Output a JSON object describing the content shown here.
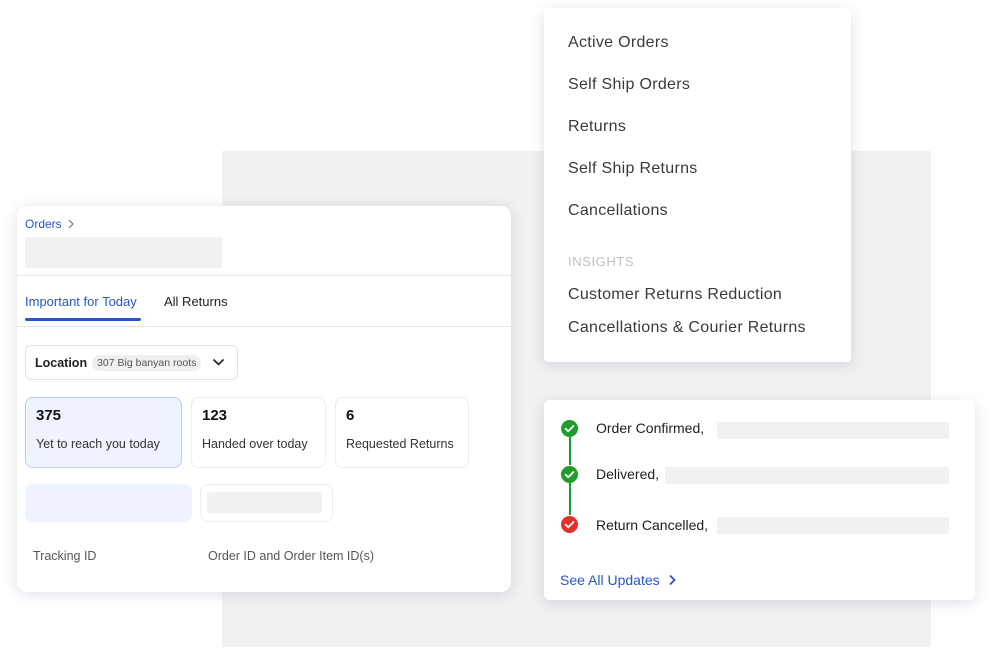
{
  "orders_panel": {
    "breadcrumb": "Orders",
    "tabs": [
      {
        "label": "Important for Today",
        "active": true
      },
      {
        "label": "All Returns",
        "active": false
      }
    ],
    "location": {
      "label": "Location",
      "value": "307 Big banyan roots"
    },
    "stats": [
      {
        "value": "375",
        "label": "Yet to reach you today"
      },
      {
        "value": "123",
        "label": "Handed over today"
      },
      {
        "value": "6",
        "label": "Requested Returns"
      }
    ],
    "columns": [
      "Tracking ID",
      "Order ID and Order Item ID(s)"
    ]
  },
  "menu": {
    "items": [
      "Active Orders",
      "Self Ship Orders",
      "Returns",
      "Self Ship Returns",
      "Cancellations"
    ],
    "section_title": "INSIGHTS",
    "insights": [
      "Customer Returns Reduction",
      "Cancellations & Courier Returns"
    ]
  },
  "updates": {
    "events": [
      {
        "label": "Order Confirmed,",
        "status": "success"
      },
      {
        "label": "Delivered,",
        "status": "success"
      },
      {
        "label": "Return Cancelled,",
        "status": "error"
      }
    ],
    "see_all": "See All Updates"
  },
  "colors": {
    "accent_blue": "#2a55c8",
    "success_green": "#1f9d2a",
    "error_red": "#e2312b",
    "placeholder_gray": "#f1f1f1"
  }
}
